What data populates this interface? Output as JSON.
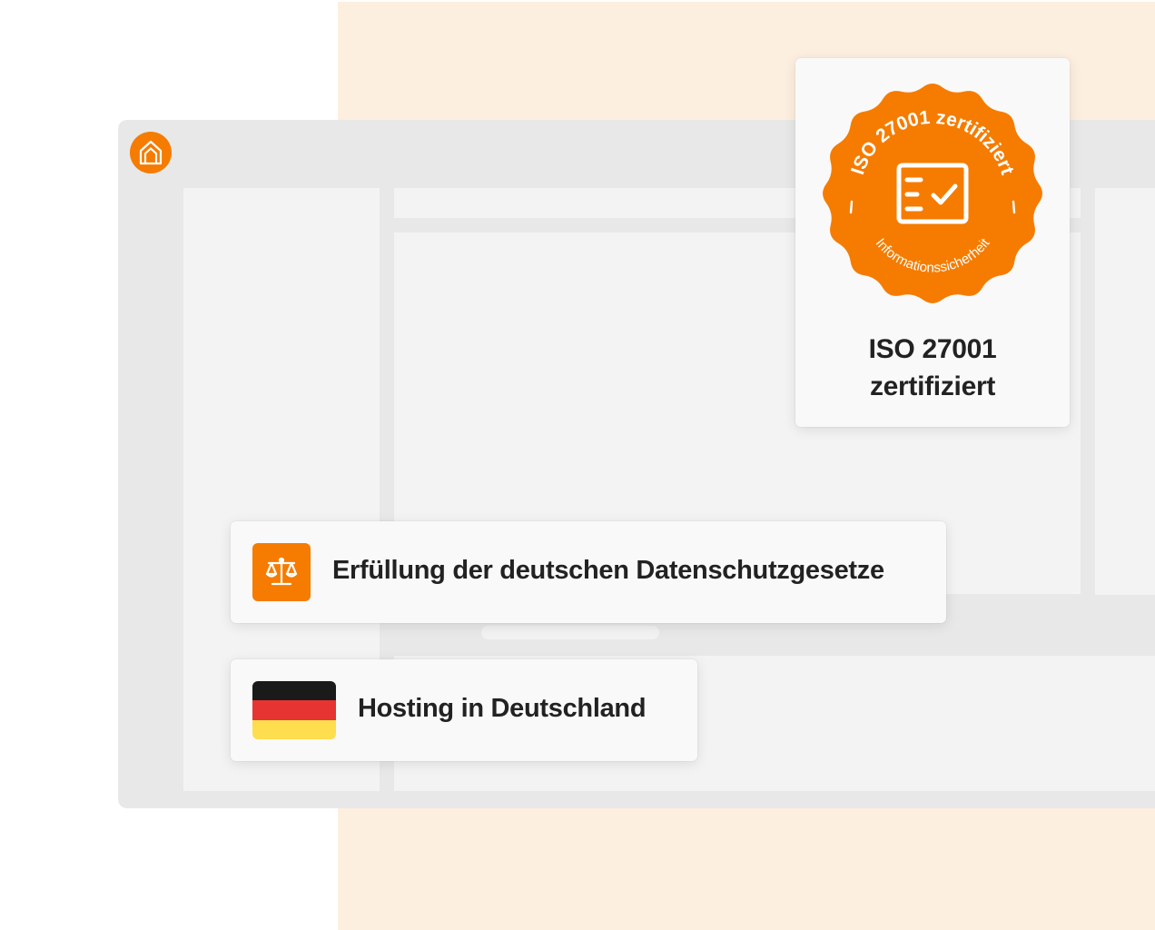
{
  "badge": {
    "arc_top": "ISO 27001 zertifiziert",
    "arc_bottom": "Informationssicherheit",
    "title_line1": "ISO 27001",
    "title_line2": "zertifiziert"
  },
  "features": {
    "law": "Erfüllung der deutschen Datenschutzgesetze",
    "hosting": "Hosting in Deutschland"
  },
  "colors": {
    "accent": "#f57c00",
    "peach_background": "#fdefe0",
    "window": "#e8e8e8",
    "panel": "#f3f3f3",
    "flag_black": "#1a1a1a",
    "flag_red": "#e53431",
    "flag_gold": "#fedd4f"
  },
  "icons": {
    "app_logo": "house-icon",
    "law": "scales-icon",
    "hosting": "germany-flag-icon",
    "seal": "certificate-seal-icon",
    "checklist": "checklist-icon"
  }
}
